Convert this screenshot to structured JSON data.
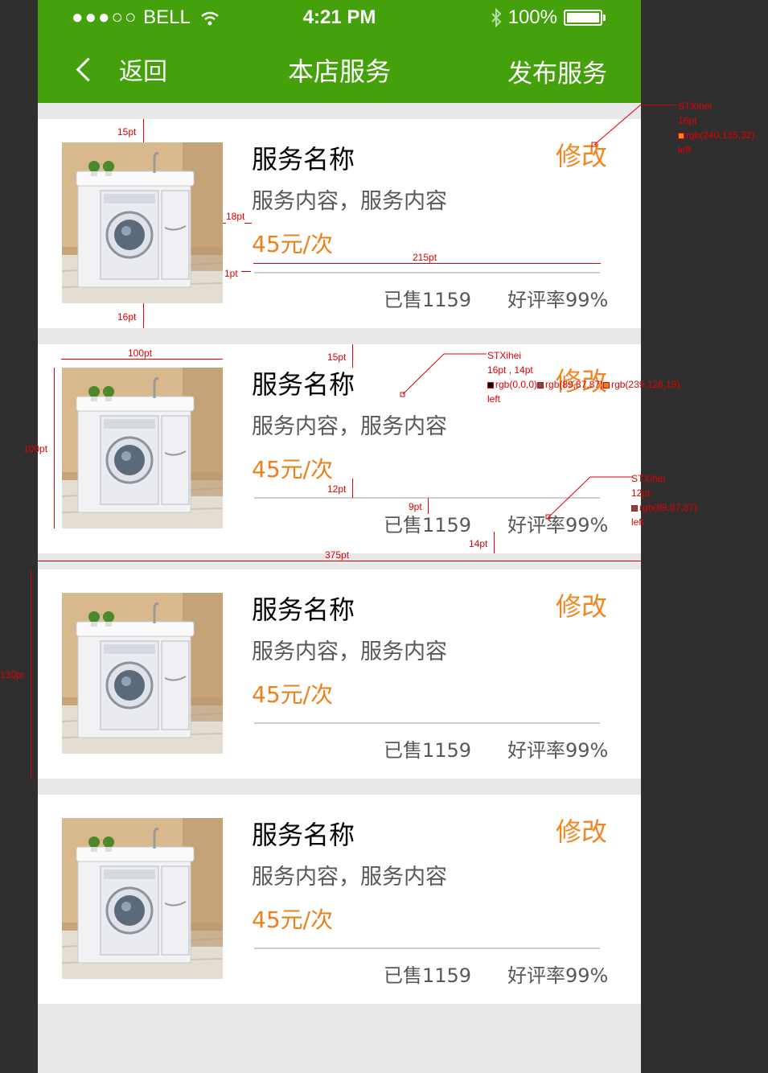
{
  "status_bar": {
    "carrier_dots": "●●●○○",
    "carrier": "BELL",
    "time": "4:21 PM",
    "battery": "100%"
  },
  "nav": {
    "back_label": "返回",
    "title": "本店服务",
    "publish_label": "发布服务"
  },
  "services": [
    {
      "name": "服务名称",
      "description": "服务内容，服务内容",
      "price": "45元/次",
      "edit_label": "修改",
      "sold": "已售1159",
      "rating": "好评率99%"
    },
    {
      "name": "服务名称",
      "description": "服务内容，服务内容",
      "price": "45元/次",
      "edit_label": "修改",
      "sold": "已售1159",
      "rating": "好评率99%"
    },
    {
      "name": "服务名称",
      "description": "服务内容，服务内容",
      "price": "45元/次",
      "edit_label": "修改",
      "sold": "已售1159",
      "rating": "好评率99%"
    },
    {
      "name": "服务名称",
      "description": "服务内容，服务内容",
      "price": "45元/次",
      "edit_label": "修改",
      "sold": "已售1159",
      "rating": "好评率99%"
    }
  ],
  "annotations": {
    "a15pt_top": "15pt",
    "a18pt": "18pt",
    "a1pt": "1pt",
    "a215pt": "215pt",
    "a16pt": "16pt",
    "a100pt_w": "100pt",
    "a100pt_h": "100pt",
    "a15pt_b": "15pt",
    "a12pt": "12pt",
    "a9pt": "9pt",
    "a14pt": "14pt",
    "a375pt": "375pt",
    "a130pt": "130pt",
    "edit_spec": {
      "font": "STXihei",
      "size": "16pt",
      "color": "rgb(240,135,32)",
      "align": "left"
    },
    "text_spec": {
      "font": "STXihei",
      "size": "16pt , 14pt",
      "color1": "rgb(0,0,0)",
      "color2": "rgb(89,87,87)",
      "color3": "rgb(239,128,19)",
      "align": "left"
    },
    "small_spec": {
      "font": "STXihei",
      "size": "12pt",
      "color": "rgb(89,87,87)",
      "align": "left"
    }
  },
  "colors": {
    "brand_green": "#44a10c",
    "accent_orange": "#f08720",
    "price_orange": "#ef8019",
    "text_gray": "#595757"
  }
}
